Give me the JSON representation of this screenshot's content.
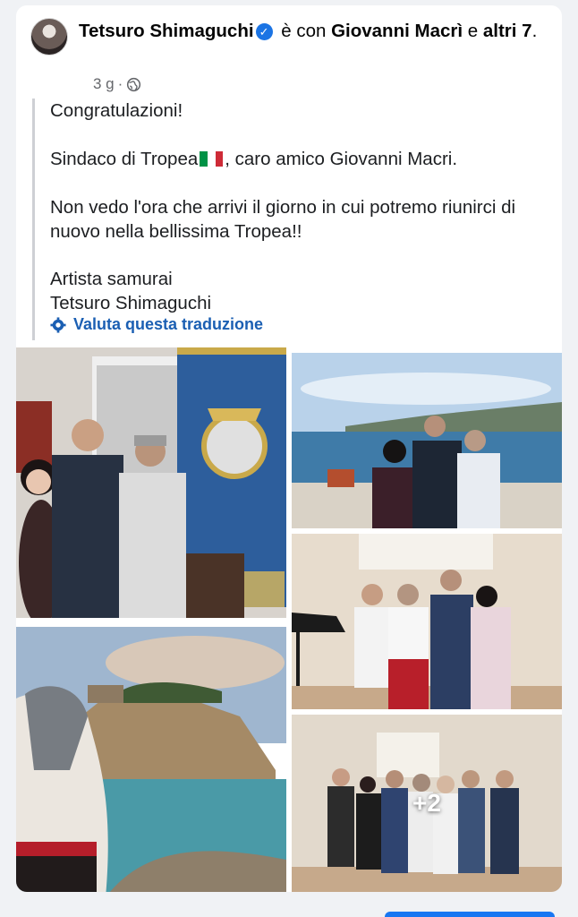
{
  "post": {
    "author": "Tetsuro  Shimaguchi",
    "with_text": "è con",
    "tagged_person": "Giovanni Macrì",
    "and_text": "e",
    "others": "altri 7",
    "period": ".",
    "time_ago": "3 g",
    "separator": "·",
    "audience_icon": "globe-icon",
    "verified_icon": "verified-badge-icon"
  },
  "translation": {
    "line1": "Congratulazioni!",
    "line2_a": "Sindaco di Tropea",
    "line2_b": ", caro amico Giovanni Macri.",
    "line3": "Non vedo l'ora che arrivi il giorno in cui potremo riunirci di nuovo nella bellissima Tropea!!",
    "line4": "Artista samurai",
    "line5": "Tetsuro Shimaguchi",
    "rate_link": "Valuta questa traduzione"
  },
  "gallery": {
    "more_count": "+2"
  },
  "colors": {
    "link_blue": "#1b5fb3",
    "verified_blue": "#1b74e4",
    "meta_gray": "#65676b"
  }
}
